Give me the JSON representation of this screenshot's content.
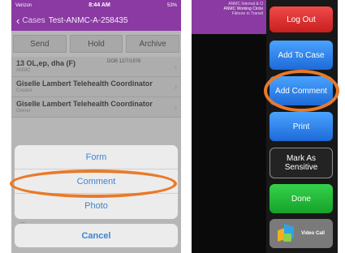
{
  "left_screen": {
    "status_bar": {
      "carrier": "Verizon",
      "time": "8:44 AM",
      "battery": "53%"
    },
    "nav": {
      "back_label": "Cases",
      "title": "Test-ANMC-A-258435"
    },
    "toolbar": {
      "send_label": "Send",
      "hold_label": "Hold",
      "archive_label": "Archive"
    },
    "case_rows": [
      {
        "main": "13 OL,ep, dha (F)",
        "sub": "ANMC",
        "dob": "DOB 12/7/1976"
      },
      {
        "main": "Giselle Lambert Telehealth Coordinator",
        "sub": "Creator"
      },
      {
        "main": "Giselle Lambert Telehealth Coordinator",
        "sub": "Owner"
      }
    ],
    "action_sheet": {
      "options": [
        "Form",
        "Comment",
        "Photo"
      ],
      "cancel_label": "Cancel",
      "peek_text": "..."
    }
  },
  "right_screen": {
    "header": {
      "line1": "ANMC Internal & O",
      "line2": "ANMC Working Circle",
      "line3": "Filmore in Transit"
    },
    "buttons": {
      "logout": "Log Out",
      "add_to_case": "Add To Case",
      "add_comment": "Add Comment",
      "print": "Print",
      "mark_sensitive": "Mark As Sensitive",
      "done": "Done",
      "video_call": "Video Call"
    }
  },
  "colors": {
    "header_purple": "#8a3aa2",
    "highlight_orange": "#e87a2a",
    "ios_link_blue": "#3f83d4",
    "button_red": "#d93030",
    "button_blue": "#2b7fe8",
    "button_green": "#1fb935"
  },
  "icons": [
    "back-chevron-icon",
    "row-chevron-icon",
    "video-call-icon"
  ]
}
